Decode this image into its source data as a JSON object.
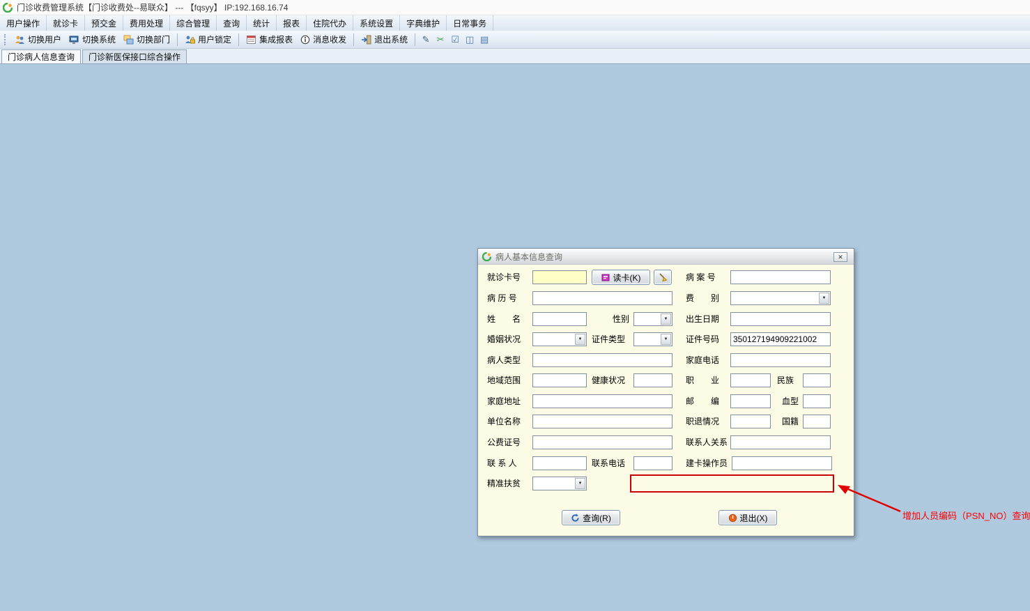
{
  "window": {
    "title": "门诊收费管理系统【门诊收费处--易联众】 --- 【fqsyy】  IP:192.168.16.74"
  },
  "menu": {
    "items": [
      {
        "label": "用户操作"
      },
      {
        "label": "就诊卡"
      },
      {
        "label": "预交金"
      },
      {
        "label": "费用处理"
      },
      {
        "label": "综合管理"
      },
      {
        "label": "查询"
      },
      {
        "label": "统计"
      },
      {
        "label": "报表"
      },
      {
        "label": "住院代办"
      },
      {
        "label": "系统设置"
      },
      {
        "label": "字典维护"
      },
      {
        "label": "日常事务"
      }
    ]
  },
  "toolbar": {
    "buttons": [
      {
        "label": "切换用户",
        "icon": "switch-user-icon"
      },
      {
        "label": "切换系统",
        "icon": "switch-system-icon"
      },
      {
        "label": "切换部门",
        "icon": "switch-department-icon"
      },
      {
        "label": "用户锁定",
        "icon": "user-lock-icon"
      },
      {
        "label": "集成报表",
        "icon": "report-icon"
      },
      {
        "label": "消息收发",
        "icon": "message-info-icon"
      },
      {
        "label": "退出系统",
        "icon": "exit-system-icon"
      }
    ],
    "extra_icons": [
      {
        "name": "edit-icon",
        "glyph": "✎"
      },
      {
        "name": "scissors-icon",
        "glyph": "✂"
      },
      {
        "name": "checkbox-icon",
        "glyph": "☑"
      },
      {
        "name": "split-window-icon",
        "glyph": "◫"
      },
      {
        "name": "calendar-icon",
        "glyph": "▤"
      }
    ]
  },
  "tabs": {
    "items": [
      {
        "label": "门诊病人信息查询"
      },
      {
        "label": "门诊新医保接口综合操作"
      }
    ]
  },
  "dialog": {
    "title": "病人基本信息查询",
    "labels": {
      "card_no": "就诊卡号",
      "case_no": "病 案 号",
      "record_no": "病 历 号",
      "fee_type": "费　　别",
      "name": "姓　　名",
      "gender": "性别",
      "birth_date": "出生日期",
      "marital": "婚姻状况",
      "id_type": "证件类型",
      "id_no": "证件号码",
      "patient_type": "病人类型",
      "home_phone": "家庭电话",
      "region": "地域范围",
      "health": "健康状况",
      "occupation": "职　　业",
      "ethnicity": "民族",
      "home_address": "家庭地址",
      "postcode": "邮　　编",
      "blood_type": "血型",
      "employer": "单位名称",
      "retire_status": "职退情况",
      "nationality": "国籍",
      "public_fee_no": "公费证号",
      "contact_relation": "联系人关系",
      "contact_person": "联 系 人",
      "contact_phone": "联系电话",
      "card_operator": "建卡操作员",
      "poverty_aid": "精准扶贫"
    },
    "values": {
      "id_no": "350127194909221002"
    },
    "buttons": {
      "read_card": "读卡(K)",
      "query": "查询(R)",
      "exit": "退出(X)"
    },
    "colors": {
      "highlight_border": "#CC0000",
      "card_input_bg": "#FFFFC6",
      "body_bg": "#FBFBE6"
    }
  },
  "annotation": {
    "text": "增加人员编码（PSN_NO）查询",
    "color": "#FF0000"
  }
}
